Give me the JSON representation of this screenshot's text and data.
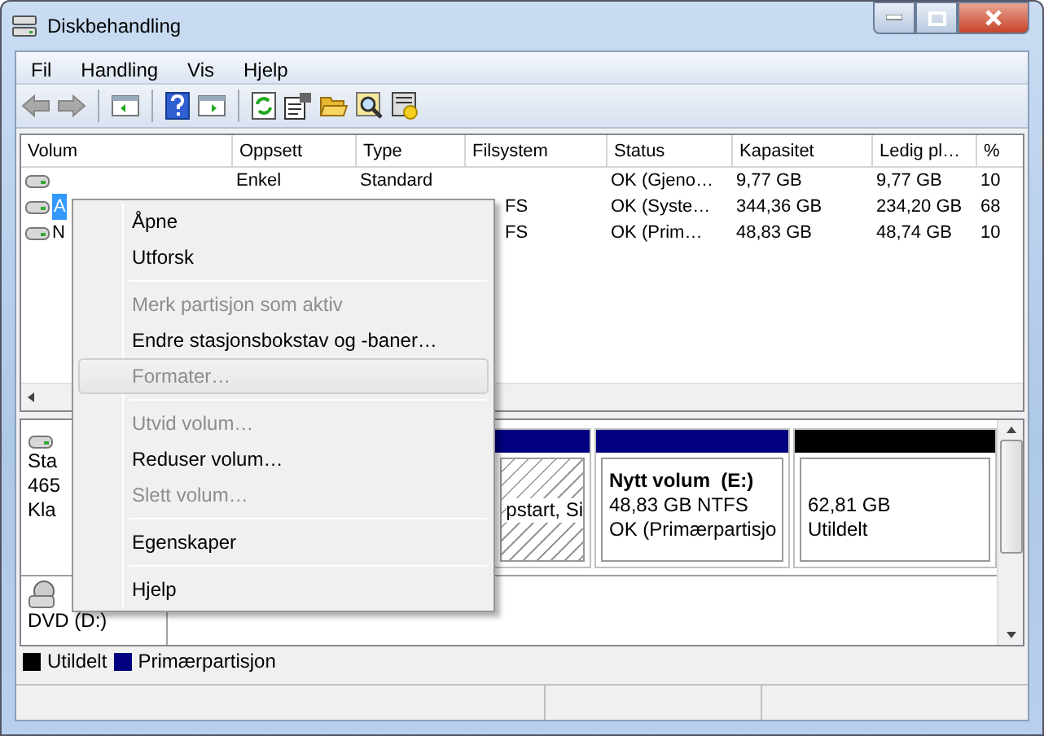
{
  "window": {
    "title": "Diskbehandling"
  },
  "menu_bar": [
    "Fil",
    "Handling",
    "Vis",
    "Hjelp"
  ],
  "volume_table": {
    "columns": [
      "Volum",
      "Oppsett",
      "Type",
      "Filsystem",
      "Status",
      "Kapasitet",
      "Ledig pl…",
      "%"
    ],
    "rows": [
      {
        "selected": false,
        "layout": "Enkel",
        "type": "Standard",
        "status": "OK (Gjeno…",
        "capacity": "9,77 GB",
        "free": "9,77 GB",
        "percent": "10"
      },
      {
        "selected": true,
        "volume": "A",
        "filesystem": "FS",
        "status": "OK (Syste…",
        "capacity": "344,36 GB",
        "free": "234,20 GB",
        "percent": "68"
      },
      {
        "selected": false,
        "volume": "N",
        "filesystem": "FS",
        "status": "OK (Prim…",
        "capacity": "48,83 GB",
        "free": "48,74 GB",
        "percent": "10"
      }
    ]
  },
  "disks": [
    {
      "kind": "disk",
      "label_lines": [
        "Sta",
        "465",
        "Kla"
      ],
      "partitions": [
        {
          "kind": "primary",
          "hatched": true,
          "color": "#000080",
          "lines": [
            "pstart, Si"
          ]
        },
        {
          "kind": "primary",
          "hatched": false,
          "color": "#000080",
          "name": "Nytt volum  (E:)",
          "lines": [
            "48,83 GB NTFS",
            "OK (Primærpartisjo"
          ]
        },
        {
          "kind": "unallocated",
          "hatched": false,
          "color": "#000000",
          "lines": [
            "62,81 GB",
            "Utildelt"
          ]
        }
      ]
    },
    {
      "kind": "cdrom",
      "label_lines": [
        "DVD (D:)"
      ]
    }
  ],
  "legend": [
    {
      "label": "Utildelt",
      "color": "#000000"
    },
    {
      "label": "Primærpartisjon",
      "color": "#000080"
    }
  ],
  "context_menu": [
    {
      "kind": "item",
      "label": "Åpne",
      "disabled": false,
      "selected": false
    },
    {
      "kind": "item",
      "label": "Utforsk",
      "disabled": false,
      "selected": false
    },
    {
      "kind": "separator"
    },
    {
      "kind": "item",
      "label": "Merk partisjon som aktiv",
      "disabled": true,
      "selected": false
    },
    {
      "kind": "item",
      "label": "Endre stasjonsbokstav og -baner…",
      "disabled": false,
      "selected": false
    },
    {
      "kind": "item",
      "label": "Formater…",
      "disabled": true,
      "selected": true
    },
    {
      "kind": "separator"
    },
    {
      "kind": "item",
      "label": "Utvid volum…",
      "disabled": true,
      "selected": false
    },
    {
      "kind": "item",
      "label": "Reduser volum…",
      "disabled": false,
      "selected": false
    },
    {
      "kind": "item",
      "label": "Slett volum…",
      "disabled": true,
      "selected": false
    },
    {
      "kind": "separator"
    },
    {
      "kind": "item",
      "label": "Egenskaper",
      "disabled": false,
      "selected": false
    },
    {
      "kind": "separator"
    },
    {
      "kind": "item",
      "label": "Hjelp",
      "disabled": false,
      "selected": false
    }
  ]
}
